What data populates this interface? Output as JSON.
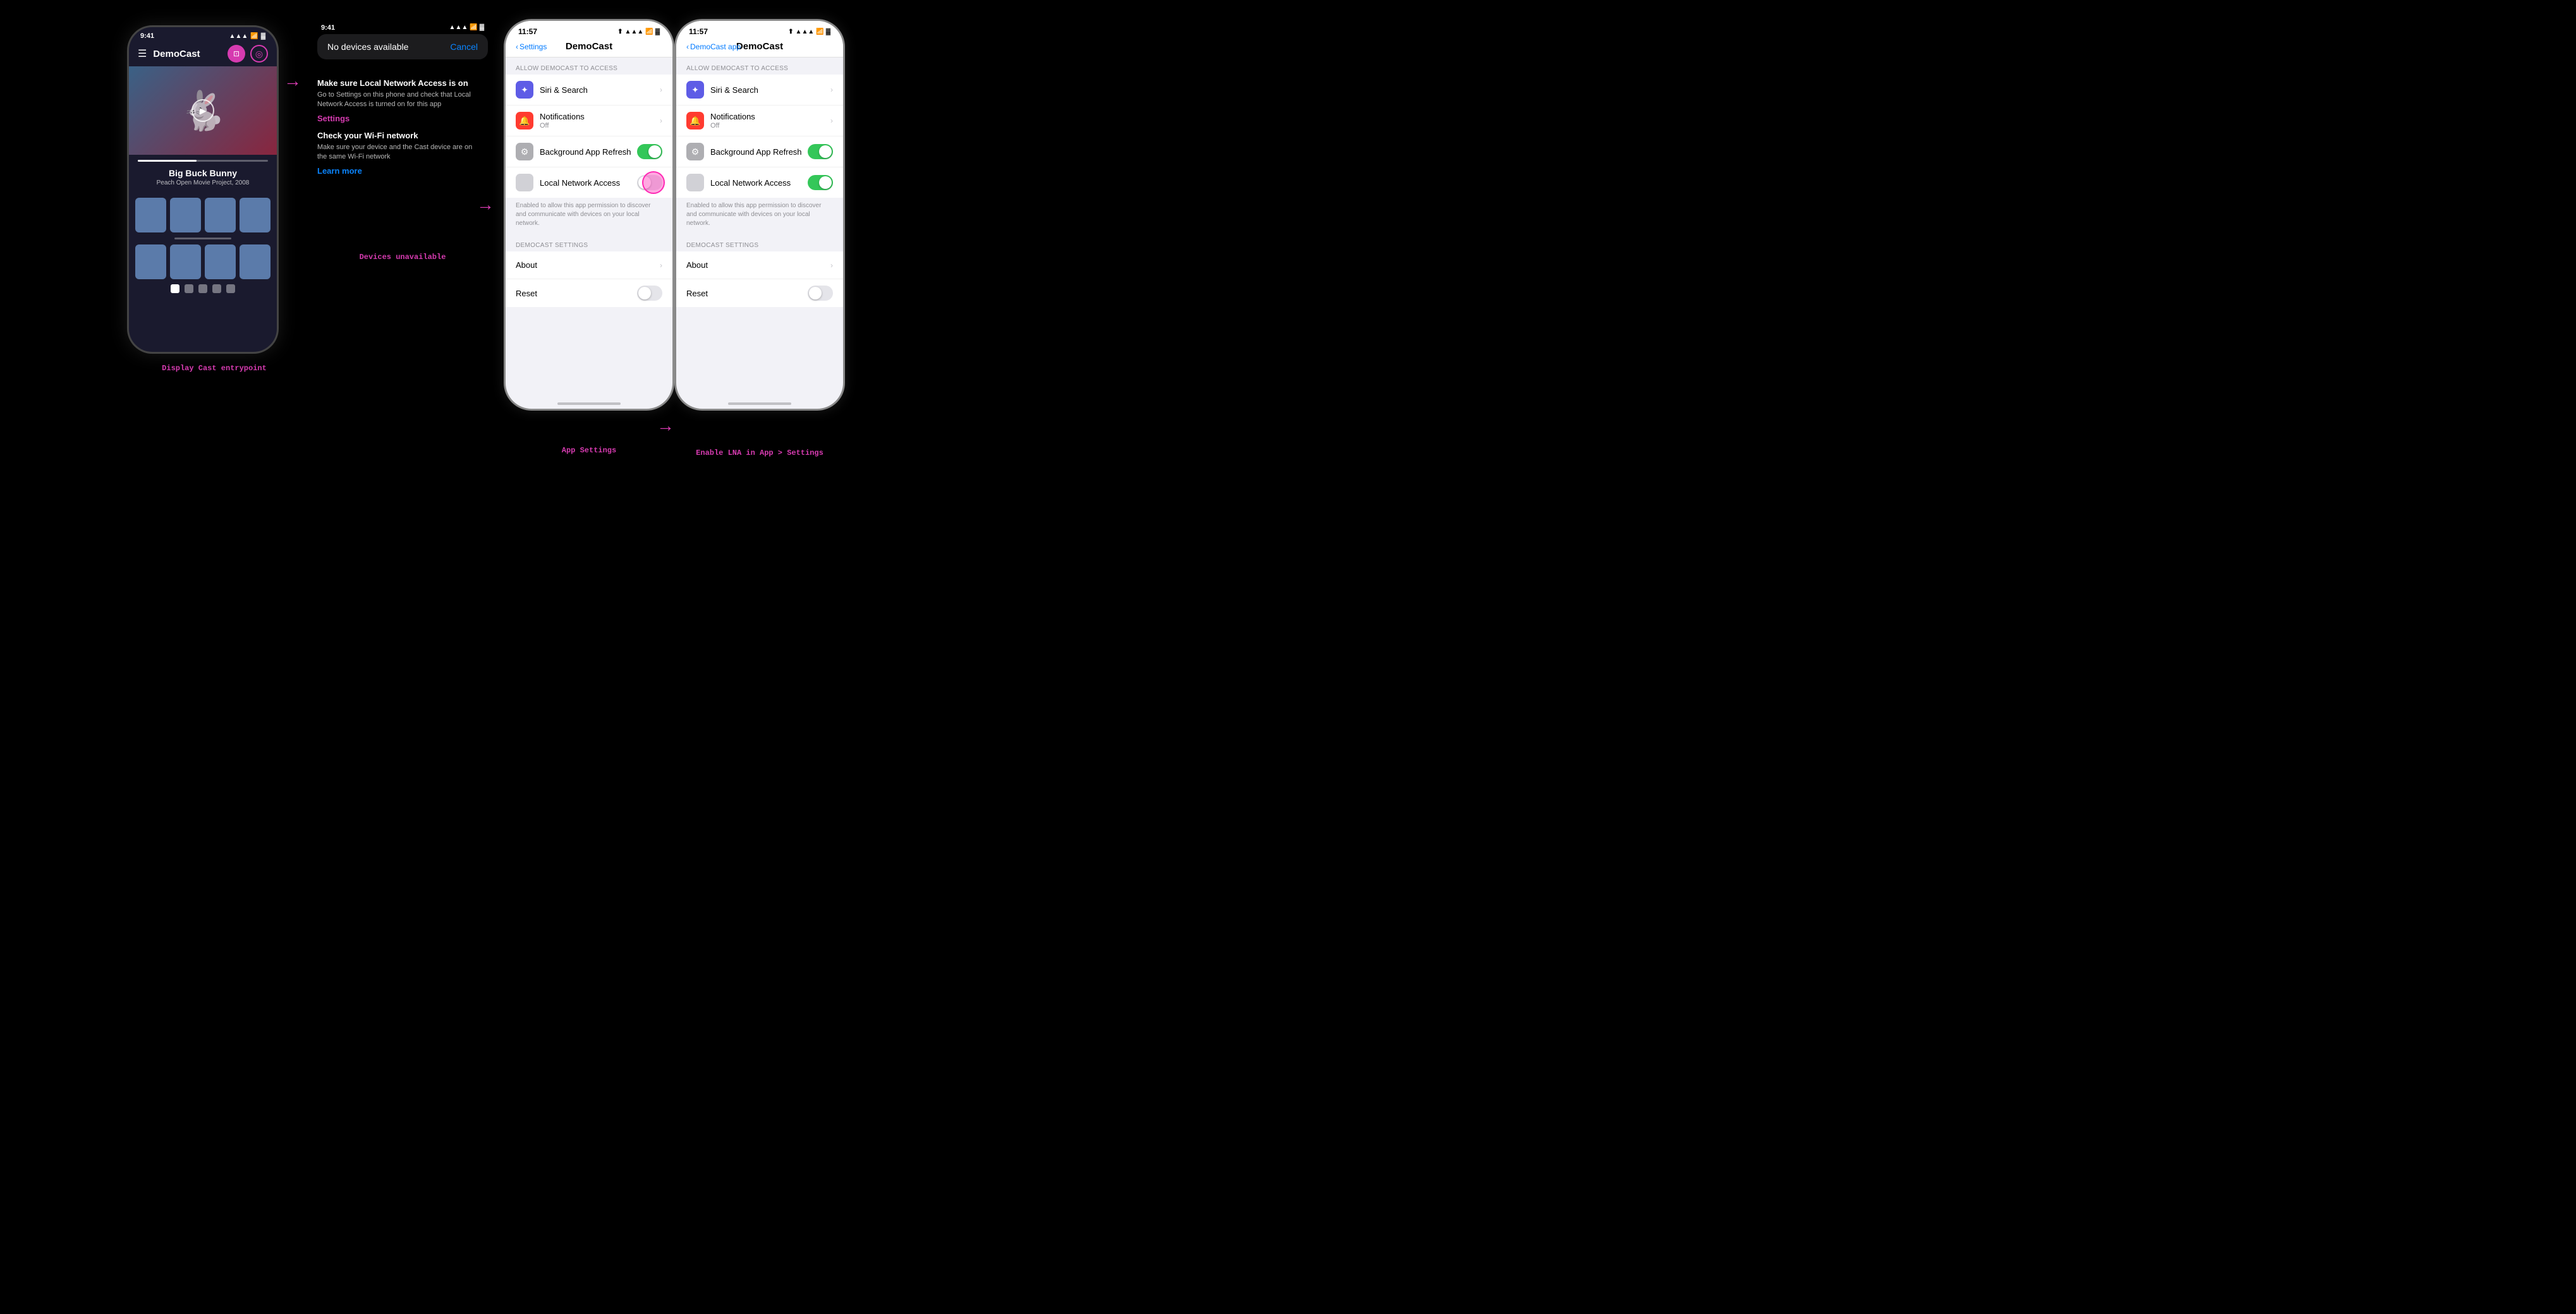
{
  "app": {
    "title": "DemoCast"
  },
  "phone1": {
    "status": {
      "time": "9:41",
      "signal": "▲▲▲",
      "wifi": "wifi",
      "battery": "🔋"
    },
    "toolbar": {
      "title": "DemoCast"
    },
    "hero": {
      "title": "Big Buck Bunny",
      "subtitle": "Peach Open Movie Project, 2008"
    },
    "label": "Display Cast entrypoint"
  },
  "section2": {
    "status": {
      "time": "9:41"
    },
    "dialog": {
      "title": "No devices available",
      "cancel": "Cancel"
    },
    "instructions": {
      "heading1": "Make sure Local Network Access is on",
      "text1": "Go to Settings on this phone and check that Local Network Access is turned on for this app",
      "link1": "Settings",
      "heading2": "Check your Wi-Fi network",
      "text2": "Make sure your device and the Cast device are on the same Wi-Fi network",
      "link2": "Learn more"
    },
    "label": "Devices unavailable"
  },
  "settings1": {
    "status": {
      "time": "11:57"
    },
    "back": "Settings",
    "title": "DemoCast",
    "section_header": "ALLOW DEMOCAST TO ACCESS",
    "items": [
      {
        "icon": "siri",
        "label": "Siri & Search",
        "type": "chevron"
      },
      {
        "icon": "notif",
        "label": "Notifications",
        "sublabel": "Off",
        "type": "chevron"
      },
      {
        "icon": "gear",
        "label": "Background App Refresh",
        "type": "toggle",
        "state": "on"
      },
      {
        "icon": "network",
        "label": "Local Network Access",
        "type": "toggle-tapping",
        "state": "off"
      }
    ],
    "description": "Enabled to allow this app permission to discover and communicate with devices on your local network.",
    "settings_header": "DEMOCAST SETTINGS",
    "settings_items": [
      {
        "label": "About",
        "type": "chevron"
      },
      {
        "label": "Reset",
        "type": "toggle",
        "state": "off"
      }
    ],
    "label": "App Settings"
  },
  "settings2": {
    "status": {
      "time": "11:57"
    },
    "back": "DemoCast app",
    "title": "DemoCast",
    "section_header": "ALLOW DEMOCAST TO ACCESS",
    "items": [
      {
        "icon": "siri",
        "label": "Siri & Search",
        "type": "chevron"
      },
      {
        "icon": "notif",
        "label": "Notifications",
        "sublabel": "Off",
        "type": "chevron"
      },
      {
        "icon": "gear",
        "label": "Background App Refresh",
        "type": "toggle",
        "state": "on"
      },
      {
        "icon": "network",
        "label": "Local Network Access",
        "type": "toggle",
        "state": "on"
      }
    ],
    "description": "Enabled to allow this app permission to discover and communicate with devices on your local network.",
    "settings_header": "DEMOCAST SETTINGS",
    "settings_items": [
      {
        "label": "About",
        "type": "chevron"
      },
      {
        "label": "Reset",
        "type": "toggle",
        "state": "off"
      }
    ],
    "label": "Enable LNA in App > Settings"
  }
}
